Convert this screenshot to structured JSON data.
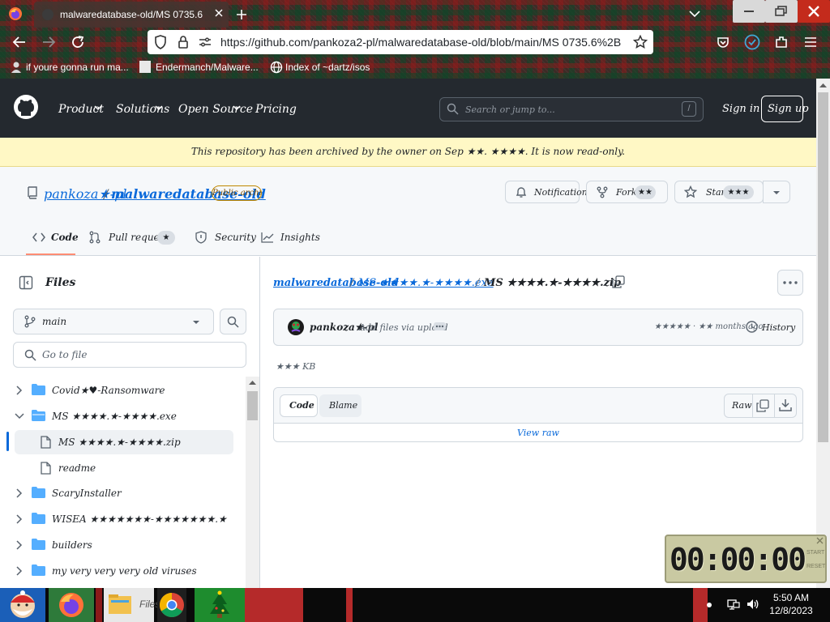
{
  "browser": {
    "tab_title": "malwaredatabase-old/MS 0735.6",
    "url": "https://github.com/pankoza2-pl/malwaredatabase-old/blob/main/MS 0735.6%2B",
    "bookmarks": [
      {
        "label": "if youre gonna run ma..."
      },
      {
        "label": "Endermanch/Malware..."
      },
      {
        "label": "Index of ~dartz/isos"
      }
    ],
    "icons": [
      "firefox-icon",
      "new-tab-icon",
      "back-icon",
      "forward-icon",
      "reload-icon",
      "shield-icon",
      "lock-icon",
      "star-icon",
      "pocket-icon",
      "extensions-icon",
      "menu-icon"
    ]
  },
  "github": {
    "nav": [
      "Product",
      "Solutions",
      "Open Source",
      "Pricing"
    ],
    "search_placeholder": "Search or jump to...",
    "slash_key": "/",
    "sign_in": "Sign in",
    "sign_up": "Sign up",
    "banner": "This repository has been archived by the owner on Sep ★★. ★★★★. It is now read-only.",
    "repo": {
      "owner": "pankoza★-pl",
      "name": "malwaredatabase-old",
      "badge": "Public archive",
      "notifications": "Notifications",
      "fork": "Fork",
      "fork_count": "★★",
      "star": "Star",
      "star_count": "★★★"
    },
    "tabs": [
      {
        "label": "Code"
      },
      {
        "label": "Pull requests"
      },
      {
        "label": "Security"
      },
      {
        "label": "Insights"
      }
    ],
    "pr_count": "★",
    "files_label": "Files",
    "branch": "main",
    "goto_placeholder": "Go to file",
    "tree": [
      {
        "label": "Covid★♥-Ransomware",
        "type": "folder",
        "expanded": false
      },
      {
        "label": "MS ★★★★.★-★★★★.exe",
        "type": "folder",
        "expanded": true
      },
      {
        "label": "MS ★★★★.★-★★★★.zip",
        "type": "file",
        "selected": true
      },
      {
        "label": "readme",
        "type": "file"
      },
      {
        "label": "ScaryInstaller",
        "type": "folder",
        "expanded": false
      },
      {
        "label": "WISEA ★★★★★★★-★★★★★★★.★",
        "type": "folder",
        "expanded": false
      },
      {
        "label": "builders",
        "type": "folder",
        "expanded": false
      },
      {
        "label": "my very very very old viruses",
        "type": "folder",
        "expanded": false
      }
    ],
    "breadcrumb": {
      "repo": "malwaredatabase-old",
      "folder": "MS ★★★★.★-★★★★.exe",
      "file": "MS ★★★★.★-★★★★.zip"
    },
    "commit": {
      "author": "pankoza★-pl",
      "message": "Add files via upload",
      "meta": "★★★★★ · ★★ months ago",
      "history": "History"
    },
    "file_size": "★★★ KB",
    "view_code": "Code",
    "view_blame": "Blame",
    "raw": "Raw",
    "view_raw": "View raw"
  },
  "stopwatch": {
    "display": "00:00:00",
    "start": "START",
    "reset": "RESET"
  },
  "taskbar": {
    "files_label": "Files",
    "time": "5:50 AM",
    "date": "12/8/2023"
  },
  "colors": {
    "github_header": "#24292f",
    "banner": "#fff8c5",
    "link": "#0969da",
    "selected_tab_underline": "#fd8c73",
    "folder": "#54aeff",
    "close_button": "#c42b1c"
  }
}
